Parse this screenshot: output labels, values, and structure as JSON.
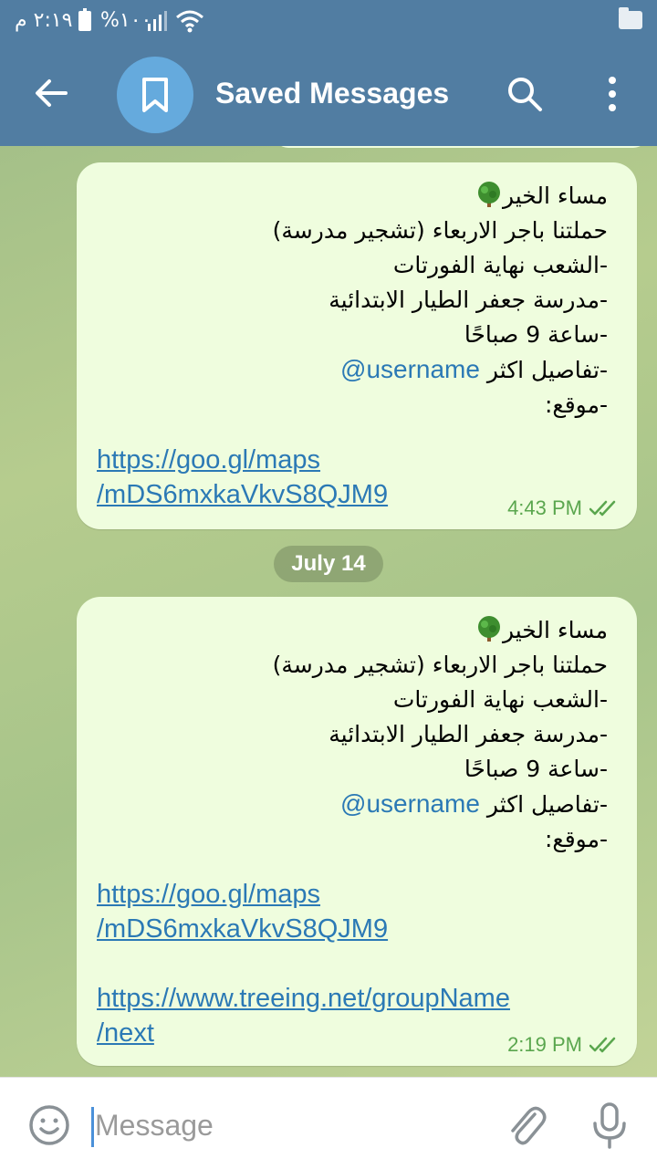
{
  "status_bar": {
    "time": "٢:١٩ م",
    "battery": "%١٠٠"
  },
  "header": {
    "title": "Saved Messages"
  },
  "messages": [
    {
      "lines": [
        "مساء الخير",
        "حملتنا باجر الاربعاء  (تشجير مدرسة)",
        "-الشعب نهاية الفورتات",
        "-مدرسة جعفر الطيار الابتدائية",
        "-ساعة 9 صباحًا",
        "-تفاصيل اكثر",
        "-موقع:"
      ],
      "mention": "@username",
      "links": [
        "https://goo.gl/maps",
        "/mDS6mxkaVkvS8QJM9"
      ],
      "time": "4:43 PM"
    },
    {
      "lines": [
        "مساء الخير",
        "حملتنا باجر الاربعاء  (تشجير مدرسة)",
        "-الشعب نهاية الفورتات",
        "-مدرسة جعفر الطيار الابتدائية",
        "-ساعة 9 صباحًا",
        "-تفاصيل اكثر",
        "-موقع:"
      ],
      "mention": "@username",
      "links": [
        "https://goo.gl/maps",
        "/mDS6mxkaVkvS8QJM9"
      ],
      "links2": [
        "https://www.treeing.net/groupName",
        "/next"
      ],
      "time": "2:19 PM"
    }
  ],
  "date_separator": "July 14",
  "input": {
    "placeholder": "Message"
  },
  "colors": {
    "header": "#517da2",
    "bubble": "#effdde",
    "link": "#2b79b5",
    "time": "#5aa64e"
  },
  "icons": [
    "back-arrow-icon",
    "bookmark-icon",
    "search-icon",
    "more-vertical-icon",
    "emoji-icon",
    "paperclip-icon",
    "microphone-icon",
    "double-check-icon",
    "tree-emoji-icon"
  ]
}
